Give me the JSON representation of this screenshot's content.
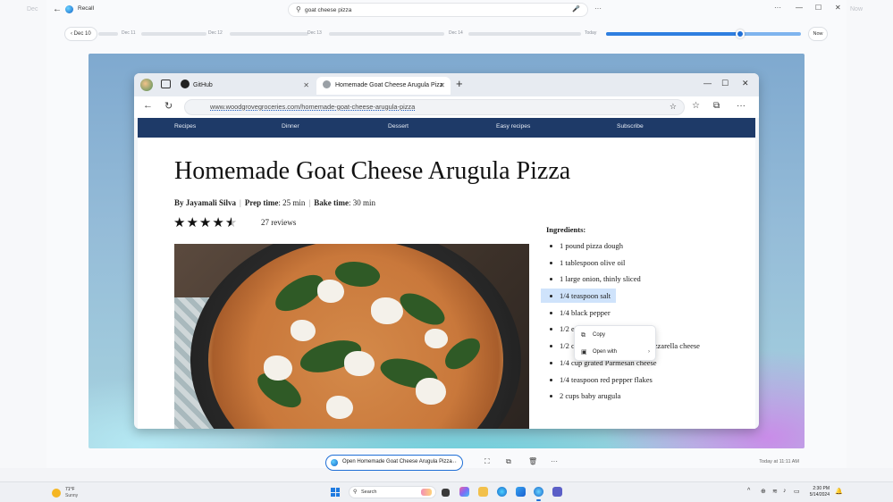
{
  "side": {
    "left_label": "Dec",
    "right_label": "Now"
  },
  "window": {
    "app_name": "Recall",
    "back_glyph": "←",
    "search_query": "goat cheese pizza",
    "search_more": "···",
    "controls": [
      "···",
      "—",
      "☐",
      "✕"
    ]
  },
  "timeline": {
    "start_label": "Dec 10",
    "labels": [
      "Dec 11",
      "Dec 12",
      "Dec 13",
      "Dec 14",
      "Today"
    ],
    "now_label": "Now",
    "position_fraction": 0.69
  },
  "browser": {
    "tabs": [
      {
        "label": "GitHub",
        "close": "✕"
      },
      {
        "label": "Homemade Goat Cheese Arugula Pizz",
        "close": "✕"
      }
    ],
    "new_tab": "+",
    "url": "www.woodgrovegroceries.com/homemade-goat-cheese-arugula-pizza",
    "nav": [
      "Recipes",
      "Dinner",
      "Dessert",
      "Easy recipes",
      "Subscribe"
    ]
  },
  "recipe": {
    "title": "Homemade Goat Cheese Arugula Pizza",
    "author_label": "By Jayamali Silva",
    "prep_label": "Prep time",
    "prep_value": ": 25 min",
    "bake_label": "Bake time",
    "bake_value": ": 30 min",
    "rating": 4.5,
    "reviews": "27 reviews",
    "ingredients_title": "Ingredients:",
    "ingredients": [
      "1 pound pizza dough",
      "1 tablespoon olive oil",
      "1 large onion, thinly sliced",
      "1/4 teaspoon salt",
      "1/4                                        black pepper",
      "1/2                                      e",
      "1/2 cup shredded part-skim mozzarella cheese",
      "1/4 cup grated Parmesan cheese",
      "1/4 teaspoon red pepper flakes",
      "2 cups baby arugula"
    ],
    "highlighted_index": 3
  },
  "context_menu": {
    "items": [
      {
        "label": "Copy",
        "icon": "copy-icon"
      },
      {
        "label": "Open with",
        "icon": "open-with-icon"
      }
    ]
  },
  "actionbar": {
    "open_label": "Open Homemade Goat Cheese Arugula Pizza",
    "more": "···",
    "timestamp": "Today at 11:11 AM"
  },
  "taskbar": {
    "temperature": "71°F",
    "condition": "Sunny",
    "search_label": "Search",
    "time": "2:30 PM",
    "date": "5/14/2024"
  }
}
